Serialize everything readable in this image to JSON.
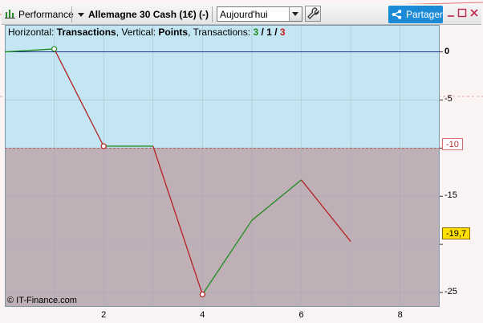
{
  "toolbar": {
    "performance_label": "Performance",
    "instrument_label": "Allemagne 30 Cash (1€) (-)",
    "period_value": "Aujourd'hui",
    "share_label": "Partager"
  },
  "chart_header": {
    "horizontal_label": "Horizontal: ",
    "horizontal_value": "Transactions",
    "vertical_label": ", Vertical: ",
    "vertical_value": "Points",
    "transactions_label": ", Transactions: ",
    "count_green": "3",
    "slash1": " / ",
    "count_black": "1",
    "slash2": " / ",
    "count_red": "3"
  },
  "copyright": "© IT-Finance.com",
  "reference_tag": "-10",
  "last_value_tag": "-19,7",
  "colors": {
    "gain": "#1f8a1f",
    "loss": "#b42020",
    "zero_line": "#1f2f8f",
    "above_bg": "#c4e6f3",
    "below_bg": "#bfb0b8",
    "share_button": "#1b8bd8",
    "last_tag": "#ffe000"
  },
  "chart_data": {
    "type": "line",
    "xlabel": "",
    "ylabel": "",
    "x_ticks": [
      "2",
      "4",
      "6",
      "8"
    ],
    "y_ticks": [
      "0",
      "-5",
      "-15",
      "-25"
    ],
    "xlim": [
      0,
      8.8
    ],
    "ylim": [
      -26.5,
      2.8
    ],
    "reference_level": -10,
    "last_value": -19.7,
    "points": [
      {
        "x": 0,
        "y": 0
      },
      {
        "x": 1,
        "y": 0.3
      },
      {
        "x": 2,
        "y": -9.8
      },
      {
        "x": 3,
        "y": -9.8
      },
      {
        "x": 4,
        "y": -25.2
      },
      {
        "x": 5,
        "y": -17.5
      },
      {
        "x": 6,
        "y": -13.3
      },
      {
        "x": 7,
        "y": -19.7
      }
    ],
    "markers": [
      {
        "x": 1,
        "y": 0.3,
        "color": "gain"
      },
      {
        "x": 2,
        "y": -9.8,
        "color": "loss"
      },
      {
        "x": 4,
        "y": -25.2,
        "color": "loss"
      }
    ],
    "grid": true
  }
}
